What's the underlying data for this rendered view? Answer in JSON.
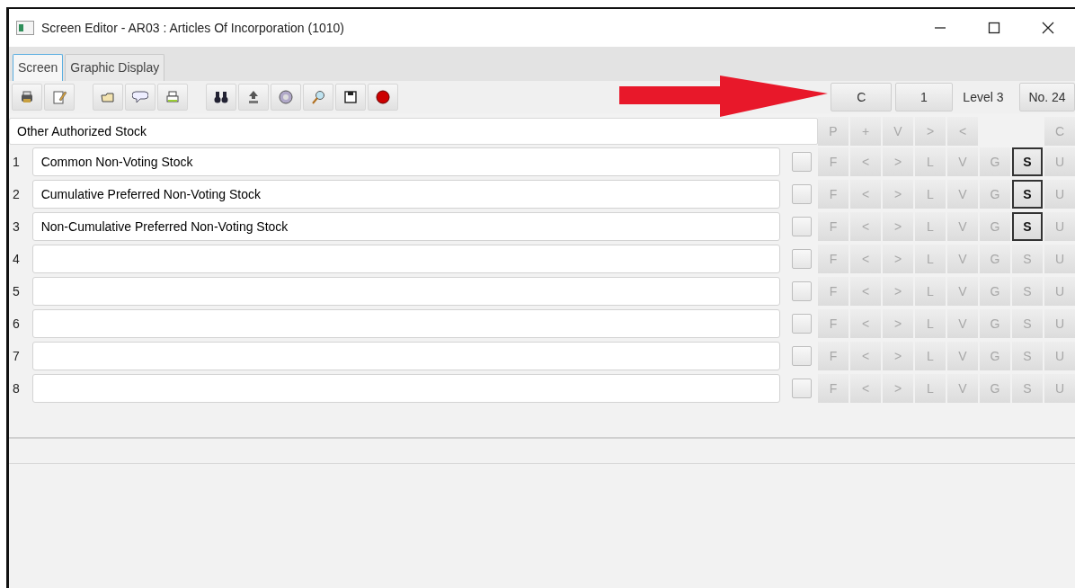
{
  "window": {
    "title": "Screen Editor - AR03 : Articles Of Incorporation (1010)"
  },
  "tabs": [
    {
      "label": "Screen",
      "selected": true
    },
    {
      "label": "Graphic Display",
      "selected": false
    }
  ],
  "header_buttons": [
    {
      "label": "C",
      "kind": "button"
    },
    {
      "label": "1",
      "kind": "button"
    },
    {
      "label": "Level 3",
      "kind": "text"
    },
    {
      "label": "No. 24",
      "kind": "button"
    }
  ],
  "section_field": {
    "value": "Other Authorized Stock"
  },
  "column_buttons": [
    {
      "label": "P",
      "kind": "button"
    },
    {
      "label": "+",
      "kind": "button"
    },
    {
      "label": "V",
      "kind": "button"
    },
    {
      "label": ">",
      "kind": "button"
    },
    {
      "label": "<",
      "kind": "button"
    },
    {
      "kind": "gap"
    },
    {
      "label": "C",
      "kind": "button"
    }
  ],
  "rows": [
    {
      "number": "1",
      "value": "Common Non-Voting Stock",
      "checked": false,
      "buttons": [
        {
          "label": "F",
          "selected": false
        },
        {
          "label": "<",
          "selected": false
        },
        {
          "label": ">",
          "selected": false
        },
        {
          "label": "L",
          "selected": false
        },
        {
          "label": "V",
          "selected": false
        },
        {
          "label": "G",
          "selected": false
        },
        {
          "label": "S",
          "selected": true
        },
        {
          "label": "U",
          "selected": false
        }
      ]
    },
    {
      "number": "2",
      "value": "Cumulative Preferred Non-Voting Stock",
      "checked": false,
      "buttons": [
        {
          "label": "F",
          "selected": false
        },
        {
          "label": "<",
          "selected": false
        },
        {
          "label": ">",
          "selected": false
        },
        {
          "label": "L",
          "selected": false
        },
        {
          "label": "V",
          "selected": false
        },
        {
          "label": "G",
          "selected": false
        },
        {
          "label": "S",
          "selected": true
        },
        {
          "label": "U",
          "selected": false
        }
      ]
    },
    {
      "number": "3",
      "value": "Non-Cumulative Preferred Non-Voting Stock",
      "checked": false,
      "buttons": [
        {
          "label": "F",
          "selected": false
        },
        {
          "label": "<",
          "selected": false
        },
        {
          "label": ">",
          "selected": false
        },
        {
          "label": "L",
          "selected": false
        },
        {
          "label": "V",
          "selected": false
        },
        {
          "label": "G",
          "selected": false
        },
        {
          "label": "S",
          "selected": true
        },
        {
          "label": "U",
          "selected": false
        }
      ]
    },
    {
      "number": "4",
      "checked": false,
      "buttons": [
        {
          "label": "F",
          "selected": false
        },
        {
          "label": "<",
          "selected": false
        },
        {
          "label": ">",
          "selected": false
        },
        {
          "label": "L",
          "selected": false
        },
        {
          "label": "V",
          "selected": false
        },
        {
          "label": "G",
          "selected": false
        },
        {
          "label": "S",
          "selected": false
        },
        {
          "label": "U",
          "selected": false
        }
      ]
    },
    {
      "number": "5",
      "checked": false,
      "buttons": [
        {
          "label": "F",
          "selected": false
        },
        {
          "label": "<",
          "selected": false
        },
        {
          "label": ">",
          "selected": false
        },
        {
          "label": "L",
          "selected": false
        },
        {
          "label": "V",
          "selected": false
        },
        {
          "label": "G",
          "selected": false
        },
        {
          "label": "S",
          "selected": false
        },
        {
          "label": "U",
          "selected": false
        }
      ]
    },
    {
      "number": "6",
      "checked": false,
      "buttons": [
        {
          "label": "F",
          "selected": false
        },
        {
          "label": "<",
          "selected": false
        },
        {
          "label": ">",
          "selected": false
        },
        {
          "label": "L",
          "selected": false
        },
        {
          "label": "V",
          "selected": false
        },
        {
          "label": "G",
          "selected": false
        },
        {
          "label": "S",
          "selected": false
        },
        {
          "label": "U",
          "selected": false
        }
      ]
    },
    {
      "number": "7",
      "checked": false,
      "buttons": [
        {
          "label": "F",
          "selected": false
        },
        {
          "label": "<",
          "selected": false
        },
        {
          "label": ">",
          "selected": false
        },
        {
          "label": "L",
          "selected": false
        },
        {
          "label": "V",
          "selected": false
        },
        {
          "label": "G",
          "selected": false
        },
        {
          "label": "S",
          "selected": false
        },
        {
          "label": "U",
          "selected": false
        }
      ]
    },
    {
      "number": "8",
      "checked": false,
      "buttons": [
        {
          "label": "F",
          "selected": false
        },
        {
          "label": "<",
          "selected": false
        },
        {
          "label": ">",
          "selected": false
        },
        {
          "label": "L",
          "selected": false
        },
        {
          "label": "V",
          "selected": false
        },
        {
          "label": "G",
          "selected": false
        },
        {
          "label": "S",
          "selected": false
        },
        {
          "label": "U",
          "selected": false
        }
      ]
    }
  ]
}
